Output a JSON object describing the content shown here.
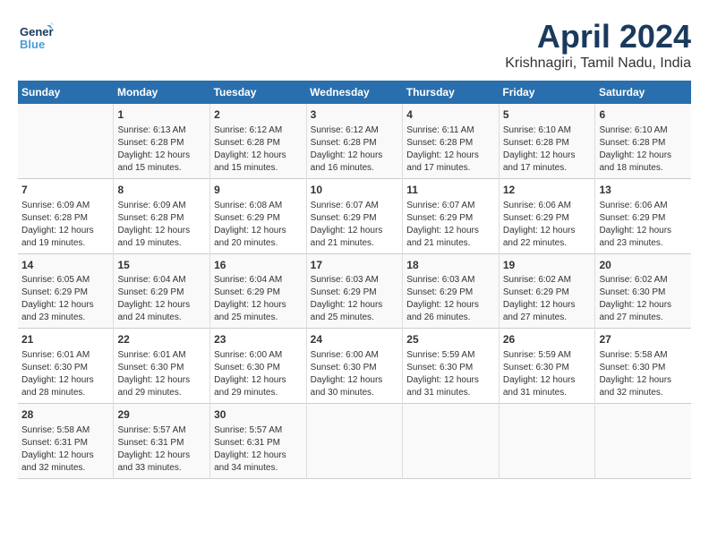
{
  "logo": {
    "general": "General",
    "blue": "Blue"
  },
  "title": "April 2024",
  "location": "Krishnagiri, Tamil Nadu, India",
  "columns": [
    "Sunday",
    "Monday",
    "Tuesday",
    "Wednesday",
    "Thursday",
    "Friday",
    "Saturday"
  ],
  "weeks": [
    [
      {
        "day": "",
        "info": ""
      },
      {
        "day": "1",
        "info": "Sunrise: 6:13 AM\nSunset: 6:28 PM\nDaylight: 12 hours\nand 15 minutes."
      },
      {
        "day": "2",
        "info": "Sunrise: 6:12 AM\nSunset: 6:28 PM\nDaylight: 12 hours\nand 15 minutes."
      },
      {
        "day": "3",
        "info": "Sunrise: 6:12 AM\nSunset: 6:28 PM\nDaylight: 12 hours\nand 16 minutes."
      },
      {
        "day": "4",
        "info": "Sunrise: 6:11 AM\nSunset: 6:28 PM\nDaylight: 12 hours\nand 17 minutes."
      },
      {
        "day": "5",
        "info": "Sunrise: 6:10 AM\nSunset: 6:28 PM\nDaylight: 12 hours\nand 17 minutes."
      },
      {
        "day": "6",
        "info": "Sunrise: 6:10 AM\nSunset: 6:28 PM\nDaylight: 12 hours\nand 18 minutes."
      }
    ],
    [
      {
        "day": "7",
        "info": "Sunrise: 6:09 AM\nSunset: 6:28 PM\nDaylight: 12 hours\nand 19 minutes."
      },
      {
        "day": "8",
        "info": "Sunrise: 6:09 AM\nSunset: 6:28 PM\nDaylight: 12 hours\nand 19 minutes."
      },
      {
        "day": "9",
        "info": "Sunrise: 6:08 AM\nSunset: 6:29 PM\nDaylight: 12 hours\nand 20 minutes."
      },
      {
        "day": "10",
        "info": "Sunrise: 6:07 AM\nSunset: 6:29 PM\nDaylight: 12 hours\nand 21 minutes."
      },
      {
        "day": "11",
        "info": "Sunrise: 6:07 AM\nSunset: 6:29 PM\nDaylight: 12 hours\nand 21 minutes."
      },
      {
        "day": "12",
        "info": "Sunrise: 6:06 AM\nSunset: 6:29 PM\nDaylight: 12 hours\nand 22 minutes."
      },
      {
        "day": "13",
        "info": "Sunrise: 6:06 AM\nSunset: 6:29 PM\nDaylight: 12 hours\nand 23 minutes."
      }
    ],
    [
      {
        "day": "14",
        "info": "Sunrise: 6:05 AM\nSunset: 6:29 PM\nDaylight: 12 hours\nand 23 minutes."
      },
      {
        "day": "15",
        "info": "Sunrise: 6:04 AM\nSunset: 6:29 PM\nDaylight: 12 hours\nand 24 minutes."
      },
      {
        "day": "16",
        "info": "Sunrise: 6:04 AM\nSunset: 6:29 PM\nDaylight: 12 hours\nand 25 minutes."
      },
      {
        "day": "17",
        "info": "Sunrise: 6:03 AM\nSunset: 6:29 PM\nDaylight: 12 hours\nand 25 minutes."
      },
      {
        "day": "18",
        "info": "Sunrise: 6:03 AM\nSunset: 6:29 PM\nDaylight: 12 hours\nand 26 minutes."
      },
      {
        "day": "19",
        "info": "Sunrise: 6:02 AM\nSunset: 6:29 PM\nDaylight: 12 hours\nand 27 minutes."
      },
      {
        "day": "20",
        "info": "Sunrise: 6:02 AM\nSunset: 6:30 PM\nDaylight: 12 hours\nand 27 minutes."
      }
    ],
    [
      {
        "day": "21",
        "info": "Sunrise: 6:01 AM\nSunset: 6:30 PM\nDaylight: 12 hours\nand 28 minutes."
      },
      {
        "day": "22",
        "info": "Sunrise: 6:01 AM\nSunset: 6:30 PM\nDaylight: 12 hours\nand 29 minutes."
      },
      {
        "day": "23",
        "info": "Sunrise: 6:00 AM\nSunset: 6:30 PM\nDaylight: 12 hours\nand 29 minutes."
      },
      {
        "day": "24",
        "info": "Sunrise: 6:00 AM\nSunset: 6:30 PM\nDaylight: 12 hours\nand 30 minutes."
      },
      {
        "day": "25",
        "info": "Sunrise: 5:59 AM\nSunset: 6:30 PM\nDaylight: 12 hours\nand 31 minutes."
      },
      {
        "day": "26",
        "info": "Sunrise: 5:59 AM\nSunset: 6:30 PM\nDaylight: 12 hours\nand 31 minutes."
      },
      {
        "day": "27",
        "info": "Sunrise: 5:58 AM\nSunset: 6:30 PM\nDaylight: 12 hours\nand 32 minutes."
      }
    ],
    [
      {
        "day": "28",
        "info": "Sunrise: 5:58 AM\nSunset: 6:31 PM\nDaylight: 12 hours\nand 32 minutes."
      },
      {
        "day": "29",
        "info": "Sunrise: 5:57 AM\nSunset: 6:31 PM\nDaylight: 12 hours\nand 33 minutes."
      },
      {
        "day": "30",
        "info": "Sunrise: 5:57 AM\nSunset: 6:31 PM\nDaylight: 12 hours\nand 34 minutes."
      },
      {
        "day": "",
        "info": ""
      },
      {
        "day": "",
        "info": ""
      },
      {
        "day": "",
        "info": ""
      },
      {
        "day": "",
        "info": ""
      }
    ]
  ]
}
